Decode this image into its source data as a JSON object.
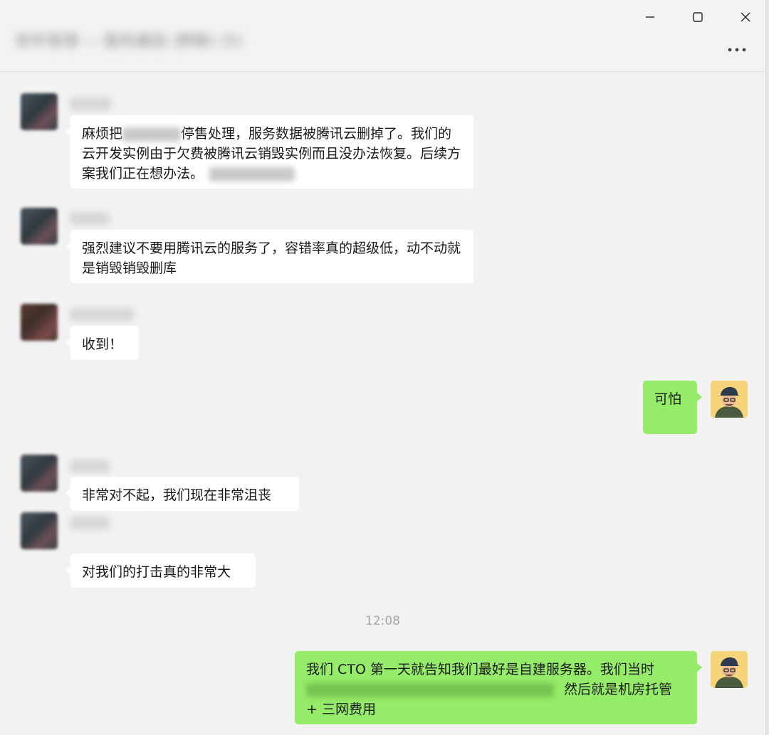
{
  "window": {
    "title": "软件管理 — 服务器组 (群聊) (5)",
    "controls": [
      "minimize-icon",
      "maximize-icon",
      "close-icon"
    ],
    "more_icon": "more-icon"
  },
  "messages": [
    {
      "direction": "in",
      "sender": "",
      "parts": [
        "麻烦把",
        "停售处理，服务数据被腾讯云删掉了。我们的云开发实例由于欠费被腾讯云销毁实例而且没办法恢复。后续方案我们正在想办法。"
      ]
    },
    {
      "direction": "in",
      "sender": "",
      "text": "强烈建议不要用腾讯云的服务了，容错率真的超级低，动不动就是销毁销毁删库"
    },
    {
      "direction": "in",
      "sender": "",
      "text": "收到！"
    },
    {
      "direction": "out",
      "text": "可怕"
    },
    {
      "direction": "in",
      "sender": "",
      "text": "非常对不起，我们现在非常沮丧"
    },
    {
      "direction": "in",
      "sender": "",
      "text": "对我们的打击真的非常大"
    },
    {
      "direction": "out",
      "parts": [
        "我们 CTO 第一天就告知我们最好是自建服务器。我们当时",
        "然后就是机房托管 + 三网费用"
      ]
    }
  ],
  "timestamp": "12:08",
  "colors": {
    "incoming_bubble": "#ffffff",
    "outgoing_bubble": "#95ec69",
    "background": "#f2f2f2"
  }
}
